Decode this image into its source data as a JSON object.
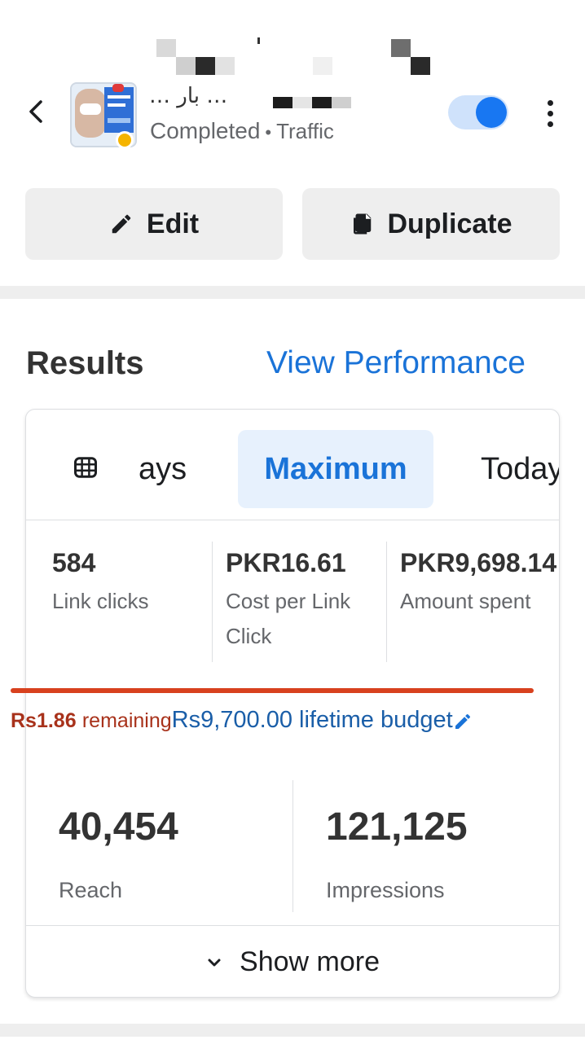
{
  "header": {
    "campaign_name": "… بار …",
    "status": "Completed",
    "objective": "Traffic",
    "toggle_on": true,
    "icons": [
      "back-arrow-icon",
      "more-vertical-icon",
      "status-dot-icon"
    ],
    "colors": {
      "accent": "#1877f2",
      "status_dot": "#f5b400"
    }
  },
  "actions": {
    "edit_label": "Edit",
    "duplicate_label": "Duplicate"
  },
  "results": {
    "title": "Results",
    "view_performance": "View Performance",
    "tabs": [
      {
        "label": "ays"
      },
      {
        "label": "Maximum",
        "selected": true
      },
      {
        "label": "Today"
      }
    ],
    "metrics": [
      {
        "value": "584",
        "label": "Link clicks"
      },
      {
        "value": "PKR16.61",
        "label": "Cost per Link Click"
      },
      {
        "value": "PKR9,698.14",
        "label": "Amount spent"
      }
    ],
    "budget": {
      "remaining_amount": "Rs1.86",
      "remaining_label": "remaining",
      "lifetime": "Rs9,700.00 lifetime budget",
      "spent_fraction": 0.9998,
      "bar_color": "#d8411e"
    },
    "big_metrics": [
      {
        "value": "40,454",
        "label": "Reach"
      },
      {
        "value": "121,125",
        "label": "Impressions"
      }
    ],
    "show_more": "Show more"
  }
}
